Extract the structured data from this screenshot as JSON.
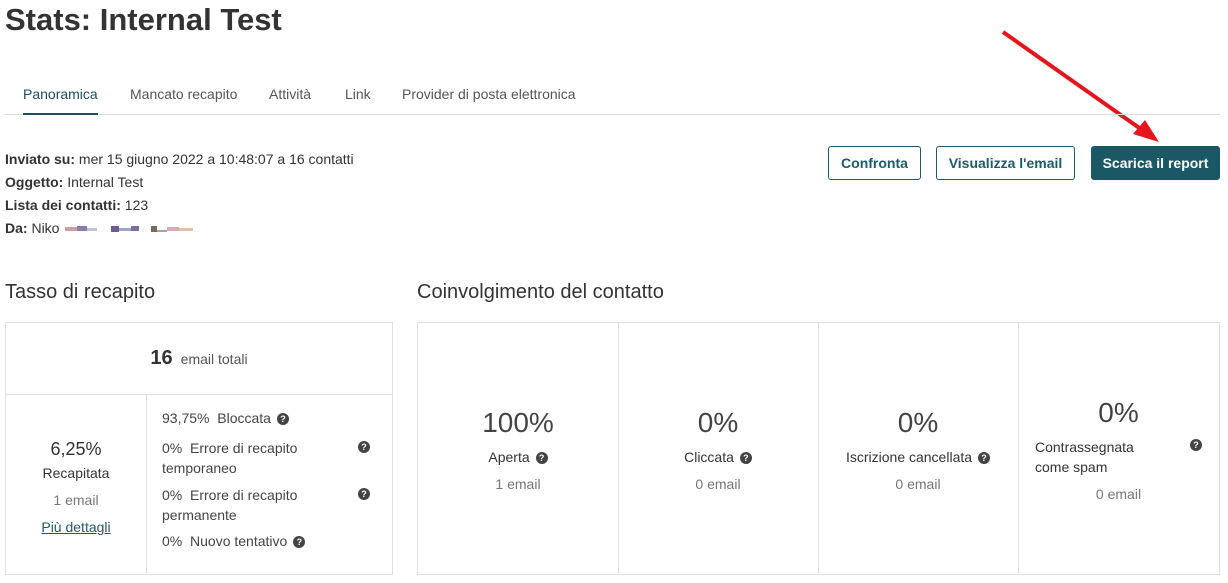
{
  "page": {
    "title": "Stats: Internal Test"
  },
  "tabs": [
    {
      "label": "Panoramica"
    },
    {
      "label": "Mancato recapito"
    },
    {
      "label": "Attività"
    },
    {
      "label": "Link"
    },
    {
      "label": "Provider di posta elettronica"
    }
  ],
  "meta": {
    "sent_label": "Inviato su:",
    "sent_value": " mer 15 giugno 2022 a 10:48:07 a 16 contatti",
    "subject_label": "Oggetto:",
    "subject_value": " Internal Test",
    "list_label": "Lista dei contatti:",
    "list_value": " 123",
    "from_label": "Da:",
    "from_value": " Niko"
  },
  "actions": {
    "compare": "Confronta",
    "view_email": "Visualizza l'email",
    "download": "Scarica il report"
  },
  "delivery": {
    "section_title": "Tasso di recapito",
    "total_number": "16",
    "total_label": "email totali",
    "delivered_pct": "6,25%",
    "delivered_label": "Recapitata",
    "delivered_count": "1 email",
    "details_link": "Più dettagli",
    "rows": [
      {
        "pct": "93,75%",
        "label": "Bloccata"
      },
      {
        "pct": "0%",
        "label": "Errore di recapito temporaneo"
      },
      {
        "pct": "0%",
        "label": "Errore di recapito permanente"
      },
      {
        "pct": "0%",
        "label": "Nuovo tentativo"
      }
    ]
  },
  "engagement": {
    "section_title": "Coinvolgimento del contatto",
    "cards": [
      {
        "pct": "100%",
        "label": "Aperta",
        "count": "1 email"
      },
      {
        "pct": "0%",
        "label": "Cliccata",
        "count": "0 email"
      },
      {
        "pct": "0%",
        "label": "Iscrizione cancellata",
        "count": "0 email"
      },
      {
        "pct": "0%",
        "label": "Contrassegnata come spam",
        "count": "0 email"
      }
    ]
  },
  "colors": {
    "accent": "#1a5866",
    "arrow": "#e8141b"
  }
}
